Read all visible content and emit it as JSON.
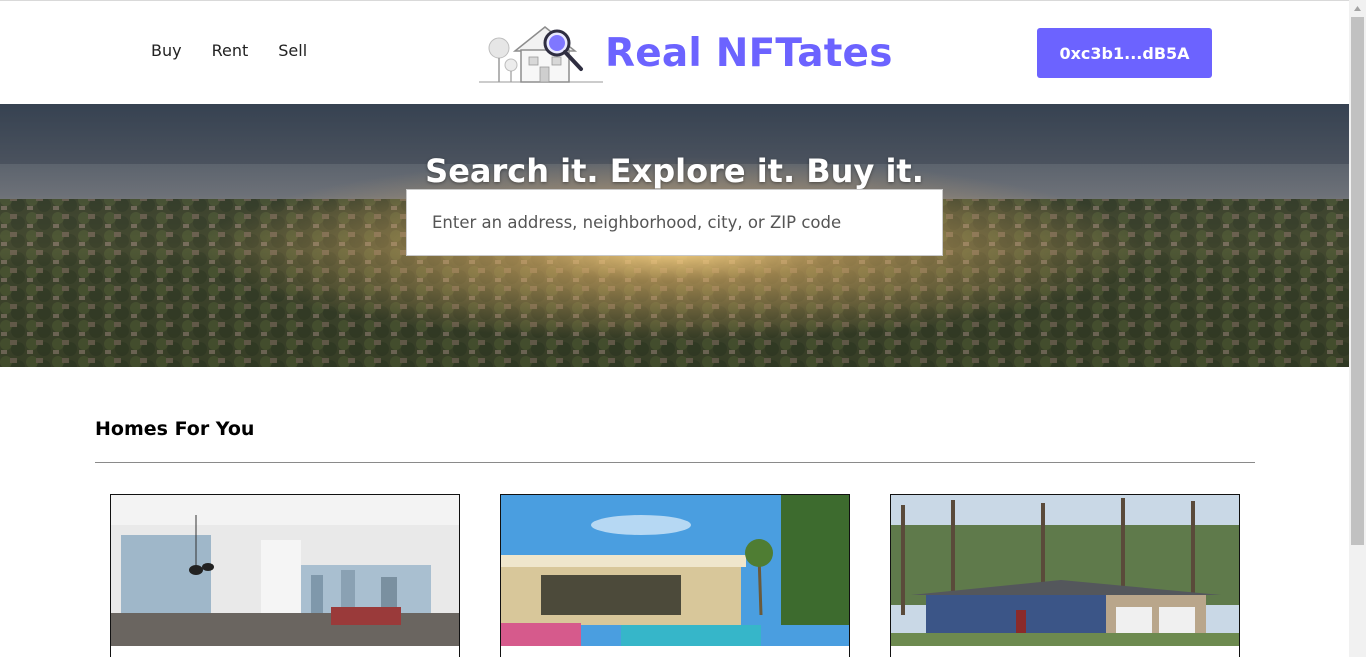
{
  "nav": {
    "items": [
      {
        "label": "Buy"
      },
      {
        "label": "Rent"
      },
      {
        "label": "Sell"
      }
    ]
  },
  "brand": {
    "title": "Real NFTates",
    "logo_icon": "house-magnifier-logo",
    "accent_color": "#6c63ff"
  },
  "wallet": {
    "label": "0xc3b1...dB5A"
  },
  "hero": {
    "title": "Search it. Explore it. Buy it.",
    "search_placeholder": "Enter an address, neighborhood, city, or ZIP code"
  },
  "homes": {
    "title": "Homes For You",
    "cards": [
      {
        "image": "modern-apartment-interior"
      },
      {
        "image": "desert-house-with-pool"
      },
      {
        "image": "blue-house-with-pine-trees"
      }
    ]
  }
}
